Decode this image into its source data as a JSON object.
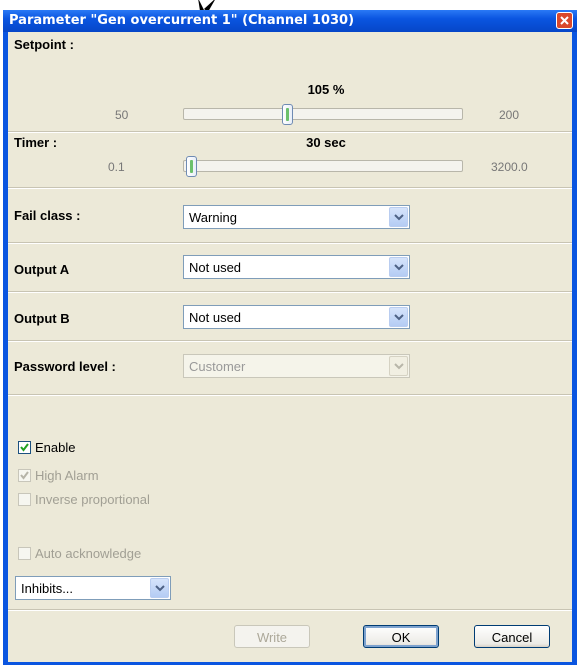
{
  "dialog": {
    "title": "Parameter \"Gen overcurrent 1\" (Channel 1030)",
    "close_icon": "close-icon"
  },
  "setpoint": {
    "label": "Setpoint :",
    "value": "105 %",
    "min": "50",
    "max": "200",
    "level": 0.367
  },
  "timer": {
    "label": "Timer :",
    "value": "30 sec",
    "min": "0.1",
    "max": "3200.0",
    "level": 0.009
  },
  "fail_class": {
    "label": "Fail class :",
    "selected": "Warning"
  },
  "output_a": {
    "label": "Output A",
    "selected": "Not used"
  },
  "output_b": {
    "label": "Output B",
    "selected": "Not used"
  },
  "password_level": {
    "label": "Password level :",
    "selected": "Customer",
    "enabled": false
  },
  "checkboxes": {
    "enable": {
      "label": "Enable",
      "checked": true,
      "enabled": true
    },
    "high_alarm": {
      "label": "High Alarm",
      "checked": true,
      "enabled": false
    },
    "inverse_proportional": {
      "label": "Inverse proportional",
      "checked": false,
      "enabled": false
    },
    "auto_acknowledge": {
      "label": "Auto acknowledge",
      "checked": false,
      "enabled": false
    }
  },
  "inhibits": {
    "selected": "Inhibits..."
  },
  "buttons": {
    "write": "Write",
    "ok": "OK",
    "cancel": "Cancel"
  },
  "colors": {
    "titlebar": "#0a55e0",
    "dialog_bg": "#ece9d8",
    "slider_grip": "#6cc06c"
  }
}
